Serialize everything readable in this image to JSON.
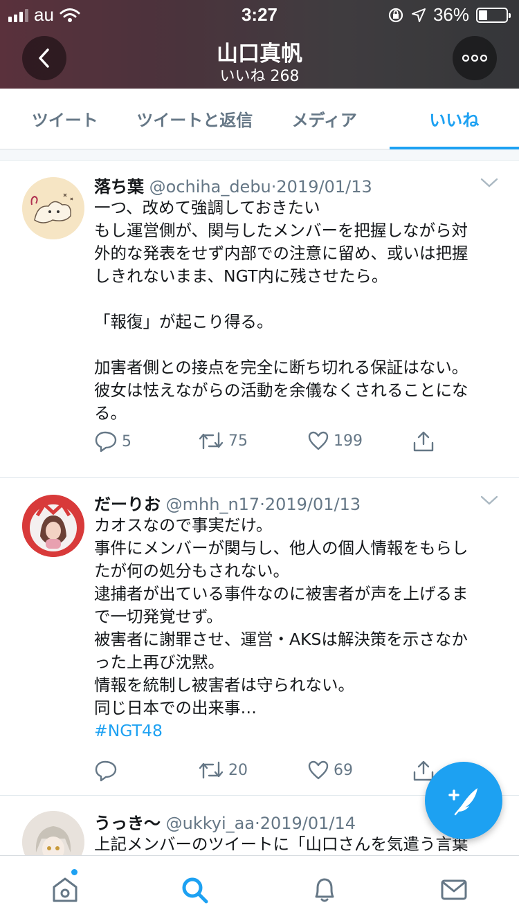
{
  "status_bar": {
    "carrier": "au",
    "time": "3:27",
    "battery": "36%"
  },
  "header": {
    "title": "山口真帆",
    "subtitle": "いいね 268"
  },
  "tabs": [
    {
      "label": "ツイート",
      "active": false
    },
    {
      "label": "ツイートと返信",
      "active": false
    },
    {
      "label": "メディア",
      "active": false
    },
    {
      "label": "いいね",
      "active": true
    }
  ],
  "tweets": [
    {
      "name": "落ち葉",
      "handle": "@ochiha_debu",
      "date": "2019/01/13",
      "lines": [
        "一つ、改めて強調しておきたい",
        "もし運営側が、関与したメンバーを把握しながら対",
        "外的な発表をせず内部での注意に留め、或いは把握",
        "しきれないまま、NGT内に残させたら。",
        "",
        "「報復」が起こり得る。",
        "",
        "加害者側との接点を完全に断ち切れる保証はない。",
        "彼女は怯えながらの活動を余儀なくされることにな",
        "る。"
      ],
      "replies": "5",
      "retweets": "75",
      "likes": "199"
    },
    {
      "name": "だーりお",
      "handle": "@mhh_n17",
      "date": "2019/01/13",
      "lines": [
        "カオスなので事実だけ。",
        "事件にメンバーが関与し、他人の個人情報をもらし",
        "たが何の処分もされない。",
        "逮捕者が出ている事件なのに被害者が声を上げるま",
        "で一切発覚せず。",
        "被害者に謝罪させ、運営・AKSは解決策を示さなか",
        "った上再び沈黙。",
        "情報を統制し被害者は守られない。",
        "同じ日本での出来事…"
      ],
      "hashtag": "#NGT48",
      "replies": "",
      "retweets": "20",
      "likes": "69"
    },
    {
      "name": "うっき〜",
      "handle": "@ukkyi_aa",
      "date": "2019/01/14",
      "lines": [
        "上記メンバーのツイートに「山口さんを気遣う言葉"
      ]
    }
  ],
  "colors": {
    "accent": "#1da1f2",
    "secondary_text": "#657786",
    "primary_text": "#14171a"
  },
  "icons": [
    "back-icon",
    "more-icon",
    "chevron-down-icon",
    "reply-icon",
    "retweet-icon",
    "like-icon",
    "share-icon",
    "compose-icon",
    "home-icon",
    "search-icon",
    "notifications-icon",
    "messages-icon"
  ]
}
